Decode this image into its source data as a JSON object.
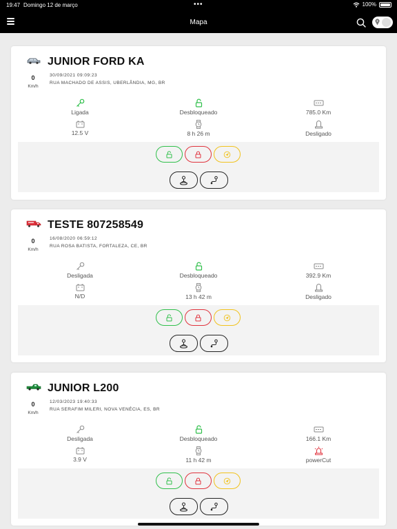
{
  "status_bar": {
    "time": "19:47",
    "date": "Domingo 12 de março",
    "dots": "•••",
    "battery_pct": "100%"
  },
  "nav": {
    "title": "Mapa"
  },
  "colors": {
    "green": "#2fbf4a",
    "red": "#e0323c",
    "yellow": "#f1c21b"
  },
  "vehicles": [
    {
      "name": "JUNIOR FORD KA",
      "icon": "car-icon",
      "speed": "0",
      "speed_unit": "Km/h",
      "datetime": "30/09/2021 09:09:23",
      "address": "RUA MACHADO DE ASSIS, UBERLÂNDIA, MG, BR",
      "ignition": "Ligada",
      "lock": "Desbloqueado",
      "odometer": "785.0 Km",
      "voltage": "12.5 V",
      "duration": "8 h 26 m",
      "alarm": "Desligado"
    },
    {
      "name": "TESTE 807258549",
      "icon": "truck-icon",
      "speed": "0",
      "speed_unit": "Km/h",
      "datetime": "16/08/2020 06:59:12",
      "address": "RUA ROSA BATISTA, FORTALEZA, CE, BR",
      "ignition": "Desligada",
      "lock": "Desbloqueado",
      "odometer": "392.9 Km",
      "voltage": "N/D",
      "duration": "13 h 42 m",
      "alarm": "Desligado"
    },
    {
      "name": "JUNIOR L200",
      "icon": "pickup-icon",
      "speed": "0",
      "speed_unit": "Km/h",
      "datetime": "12/03/2023 19:40:33",
      "address": "RUA SERAFIM MILERI, NOVA VENÉCIA, ES, BR",
      "ignition": "Desligada",
      "lock": "Desbloqueado",
      "odometer": "166.1 Km",
      "voltage": "3.9 V",
      "duration": "11 h 42 m",
      "alarm": "powerCut"
    }
  ]
}
